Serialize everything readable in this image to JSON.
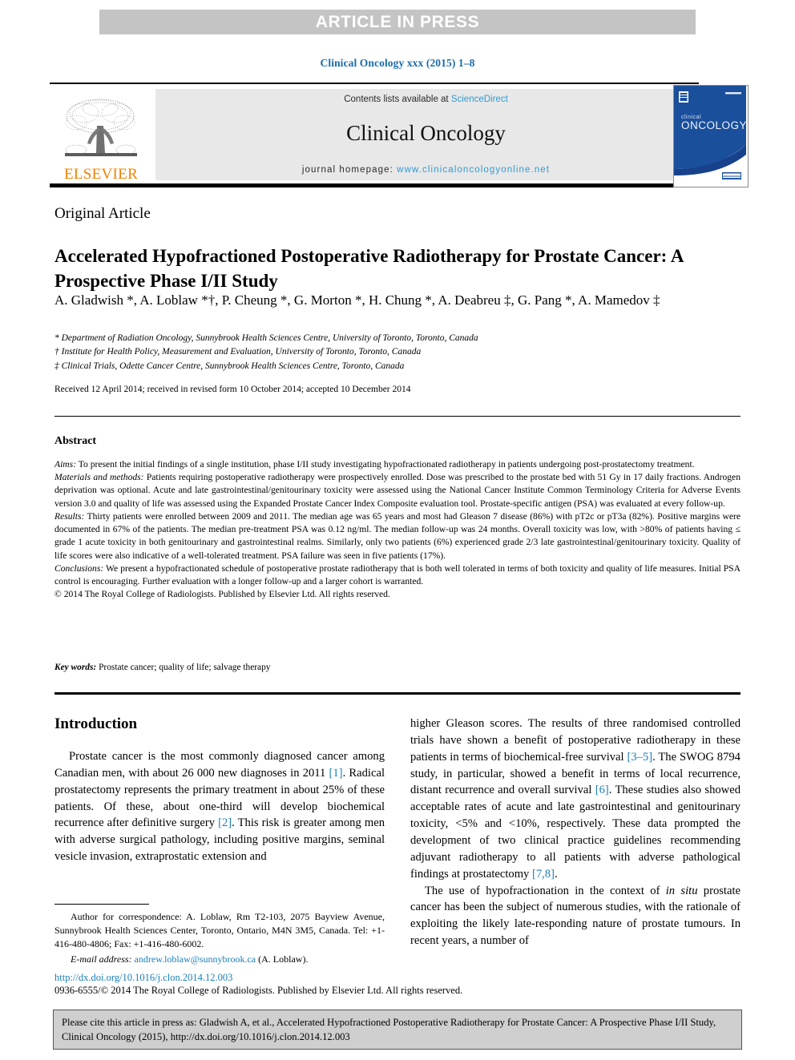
{
  "banner": {
    "text": "ARTICLE IN PRESS"
  },
  "journal_ref": "Clinical Oncology xxx (2015) 1–8",
  "masthead": {
    "contents_prefix": "Contents lists available at ",
    "sciencedirect": "ScienceDirect",
    "journal_name": "Clinical Oncology",
    "homepage_prefix": "journal homepage: ",
    "homepage_url": "www.clinicaloncologyonline.net",
    "publisher_logo_text": "ELSEVIER",
    "cover_title_small": "clinical",
    "cover_title_large": "ONCOLOGY"
  },
  "article": {
    "type": "Original Article",
    "title": "Accelerated Hypofractioned Postoperative Radiotherapy for Prostate Cancer: A Prospective Phase I/II Study",
    "authors": "A. Gladwish *, A. Loblaw *†, P. Cheung *, G. Morton *, H. Chung *, A. Deabreu ‡, G. Pang *, A. Mamedov ‡",
    "affiliations": [
      "* Department of Radiation Oncology, Sunnybrook Health Sciences Centre, University of Toronto, Toronto, Canada",
      "† Institute for Health Policy, Measurement and Evaluation, University of Toronto, Toronto, Canada",
      "‡ Clinical Trials, Odette Cancer Centre, Sunnybrook Health Sciences Centre, Toronto, Canada"
    ],
    "history": "Received 12 April 2014; received in revised form 10 October 2014; accepted 10 December 2014"
  },
  "abstract": {
    "heading": "Abstract",
    "aims_label": "Aims:",
    "aims_text": " To present the initial findings of a single institution, phase I/II study investigating hypofractionated radiotherapy in patients undergoing post-prostatectomy treatment.",
    "methods_label": "Materials and methods:",
    "methods_text": " Patients requiring postoperative radiotherapy were prospectively enrolled. Dose was prescribed to the prostate bed with 51 Gy in 17 daily fractions. Androgen deprivation was optional. Acute and late gastrointestinal/genitourinary toxicity were assessed using the National Cancer Institute Common Terminology Criteria for Adverse Events version 3.0 and quality of life was assessed using the Expanded Prostate Cancer Index Composite evaluation tool. Prostate-specific antigen (PSA) was evaluated at every follow-up.",
    "results_label": "Results:",
    "results_text": " Thirty patients were enrolled between 2009 and 2011. The median age was 65 years and most had Gleason 7 disease (86%) with pT2c or pT3a (82%). Positive margins were documented in 67% of the patients. The median pre-treatment PSA was 0.12 ng/ml. The median follow-up was 24 months. Overall toxicity was low, with >80% of patients having ≤ grade 1 acute toxicity in both genitourinary and gastrointestinal realms. Similarly, only two patients (6%) experienced grade 2/3 late gastrointestinal/genitourinary toxicity. Quality of life scores were also indicative of a well-tolerated treatment. PSA failure was seen in five patients (17%).",
    "conclusions_label": "Conclusions:",
    "conclusions_text": " We present a hypofractionated schedule of postoperative prostate radiotherapy that is both well tolerated in terms of both toxicity and quality of life measures. Initial PSA control is encouraging. Further evaluation with a longer follow-up and a larger cohort is warranted.",
    "rights_line": "© 2014 The Royal College of Radiologists. Published by Elsevier Ltd. All rights reserved."
  },
  "keywords": {
    "label": "Key words:",
    "value": " Prostate cancer; quality of life; salvage therapy"
  },
  "introduction": {
    "heading": "Introduction",
    "left_p1_a": "Prostate cancer is the most commonly diagnosed cancer among Canadian men, with about 26 000 new diagnoses in 2011 ",
    "left_ref1": "[1]",
    "left_p1_b": ". Radical prostatectomy represents the primary treatment in about 25% of these patients. Of these, about one-third will develop biochemical recurrence after definitive surgery ",
    "left_ref2": "[2]",
    "left_p1_c": ". This risk is greater among men with adverse surgical pathology, including positive margins, seminal vesicle invasion, extraprostatic extension and",
    "right_p1_a": "higher Gleason scores. The results of three randomised controlled trials have shown a benefit of postoperative radiotherapy in these patients in terms of biochemical-free survival ",
    "right_ref35": "[3–5]",
    "right_p1_b": ". The SWOG 8794 study, in particular, showed a benefit in terms of local recurrence, distant recurrence and overall survival ",
    "right_ref6": "[6]",
    "right_p1_c": ". These studies also showed acceptable rates of acute and late gastrointestinal and genitourinary toxicity, <5% and <10%, respectively. These data prompted the development of two clinical practice guidelines recommending adjuvant radiotherapy to all patients with adverse pathological findings at prostatectomy ",
    "right_ref78": "[7,8]",
    "right_p1_d": ".",
    "right_p2_a": "The use of hypofractionation in the context of ",
    "right_p2_ital": "in situ",
    "right_p2_b": " prostate cancer has been the subject of numerous studies, with the rationale of exploiting the likely late-responding nature of prostate tumours. In recent years, a number of"
  },
  "footnote": {
    "correspondence": "Author for correspondence: A. Loblaw, Rm T2-103, 2075 Bayview Avenue, Sunnybrook Health Sciences Center, Toronto, Ontario, M4N 3M5, Canada. Tel: +1-416-480-4806; Fax: +1-416-480-6002.",
    "email_label": "E-mail address:",
    "email": "andrew.loblaw@sunnybrook.ca",
    "email_suffix": " (A. Loblaw)."
  },
  "doi": "http://dx.doi.org/10.1016/j.clon.2014.12.003",
  "copyright": "0936-6555/© 2014 The Royal College of Radiologists. Published by Elsevier Ltd. All rights reserved.",
  "cite_box": {
    "text": "Please cite this article in press as: Gladwish A, et al., Accelerated Hypofractioned Postoperative Radiotherapy for Prostate Cancer: A Prospective Phase I/II Study, Clinical Oncology (2015), http://dx.doi.org/10.1016/j.clon.2014.12.003"
  },
  "colors": {
    "banner_bg": "#c4c4c4",
    "link_blue": "#1b7fb8",
    "sciencedirect_blue": "#2e9bd6",
    "elsevier_orange": "#ef8200",
    "cover_blue": "#1a4f9c",
    "cite_box_bg": "#cfcfcf"
  }
}
